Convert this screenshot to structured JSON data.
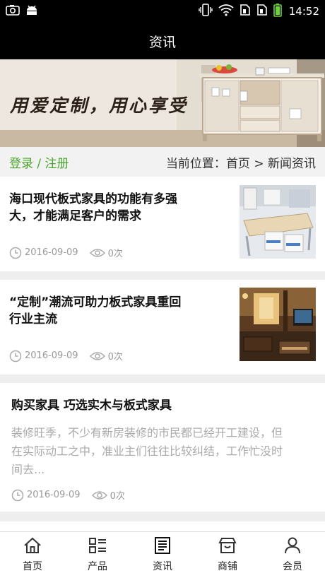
{
  "status_bar": {
    "time": "14:52",
    "icons": [
      "camera-icon",
      "android-icon",
      "vibrate-icon",
      "wifi-icon",
      "sim1-icon",
      "sim2-icon",
      "battery-icon"
    ]
  },
  "header": {
    "title": "资讯"
  },
  "banner": {
    "slogan": "用爱定制，用心享受"
  },
  "breadcrumb": {
    "login": "登录",
    "separator": "/",
    "register": "注册",
    "location_prefix": "当前位置：",
    "home": "首页",
    "arrow": ">",
    "current": "新闻资讯"
  },
  "articles": [
    {
      "title_line1": "海口现代板式家具的功能有多强",
      "title_line2": "大，才能满足客户的需求",
      "date": "2016-09-09",
      "views": "0次",
      "thumb": "office-desk-photo"
    },
    {
      "title_line1": "“定制”潮流可助力板式家具重回",
      "title_line2": "行业主流",
      "date": "2016-09-09",
      "views": "0次",
      "thumb": "living-room-photo"
    },
    {
      "title": "购买家具 巧选实木与板式家具",
      "summary_line1": "装修旺季，不少有新房装修的市民都已经开工建设，但",
      "summary_line2": "在实际动工之中，准业主们往往比较纠结，工作忙没时",
      "summary_line3": "间去...",
      "date": "2016-09-09",
      "views": "0次"
    }
  ],
  "tabbar": {
    "items": [
      {
        "label": "首页",
        "icon": "home-icon"
      },
      {
        "label": "产品",
        "icon": "list-icon"
      },
      {
        "label": "资讯",
        "icon": "news-icon"
      },
      {
        "label": "商铺",
        "icon": "shop-icon"
      },
      {
        "label": "会员",
        "icon": "user-icon"
      }
    ]
  },
  "colors": {
    "accent_green": "#4aa52e",
    "bar_black": "#000000"
  }
}
